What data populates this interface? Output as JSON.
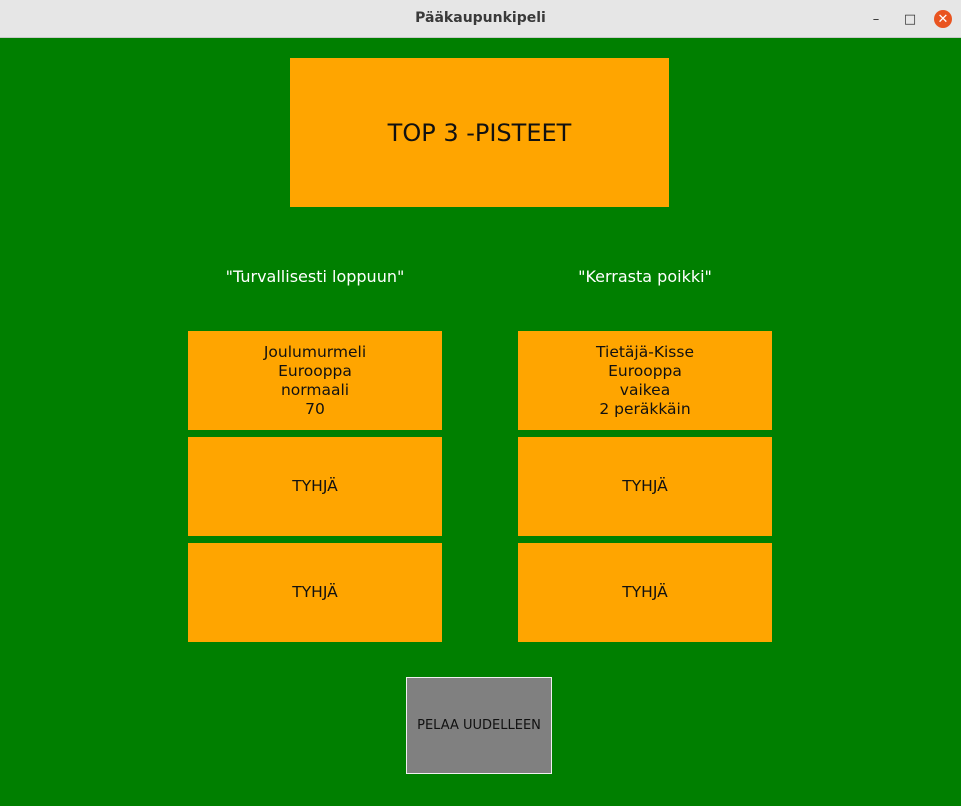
{
  "window": {
    "title": "Pääkaupunkipeli",
    "controls": {
      "minimize_icon": "minimize-icon",
      "maximize_icon": "maximize-icon",
      "close_icon": "close-icon"
    }
  },
  "header": {
    "title": "TOP 3 -PISTEET"
  },
  "columns": [
    {
      "label": "\"Turvallisesti loppuun\"",
      "slots": [
        {
          "lines": [
            "Joulumurmeli",
            "Eurooppa",
            "normaali",
            "70"
          ]
        },
        {
          "lines": [
            "TYHJÄ"
          ]
        },
        {
          "lines": [
            "TYHJÄ"
          ]
        }
      ]
    },
    {
      "label": "\"Kerrasta poikki\"",
      "slots": [
        {
          "lines": [
            "Tietäjä-Kisse",
            "Eurooppa",
            "vaikea",
            "2 peräkkäin"
          ]
        },
        {
          "lines": [
            "TYHJÄ"
          ]
        },
        {
          "lines": [
            "TYHJÄ"
          ]
        }
      ]
    }
  ],
  "actions": {
    "play_again_label": "PELAA UUDELLEEN"
  },
  "colors": {
    "background": "#007f00",
    "box": "#ffa500",
    "button": "#808080"
  }
}
